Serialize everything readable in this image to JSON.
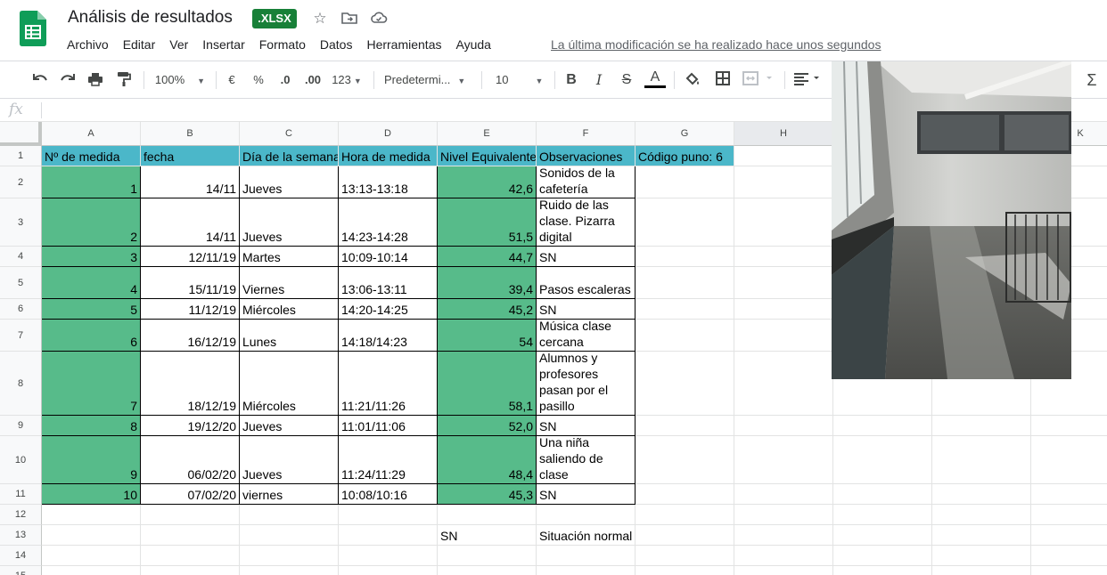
{
  "app": {
    "title": "Análisis de resultados",
    "file_badge": ".XLSX",
    "last_edit": "La última modificación se ha realizado hace unos segundos",
    "menu": [
      "Archivo",
      "Editar",
      "Ver",
      "Insertar",
      "Formato",
      "Datos",
      "Herramientas",
      "Ayuda"
    ],
    "icons": [
      "star-icon",
      "move-to-folder-icon",
      "cloud-status-icon"
    ]
  },
  "toolbar": {
    "zoom": "100%",
    "currency": "€",
    "percent": "%",
    "decrease_decimals": ".0",
    "increase_decimals": ".00",
    "more_formats": "123",
    "font": "Predetermi...",
    "font_size": "10",
    "bold": "B",
    "italic": "I",
    "strike": "S",
    "text_color": "A",
    "sum": "Σ"
  },
  "formula_bar": {
    "label": "fx",
    "content": ""
  },
  "sheet": {
    "columns": [
      "A",
      "B",
      "C",
      "D",
      "E",
      "F",
      "G",
      "H",
      "I",
      "J",
      "K"
    ],
    "row_numbers": [
      "1",
      "2",
      "3",
      "4",
      "5",
      "6",
      "7",
      "8",
      "9",
      "10",
      "11",
      "12",
      "13",
      "14",
      "15"
    ],
    "headers": {
      "A": "Nº de medida",
      "B": "fecha",
      "C": "Día de la semana",
      "D": "Hora de medida",
      "E": "Nivel Equivalente",
      "F": "Observaciones",
      "G": "Código puno: 6"
    },
    "rows": [
      {
        "n": "1",
        "fecha": "14/11",
        "dia": "Jueves",
        "hora": "13:13-13:18",
        "nivel": "42,6",
        "obs": "Sonidos de la cafetería"
      },
      {
        "n": "2",
        "fecha": "14/11",
        "dia": "Jueves",
        "hora": "14:23-14:28",
        "nivel": "51,5",
        "obs": "Ruido de las clase. Pizarra digital"
      },
      {
        "n": "3",
        "fecha": "12/11/19",
        "dia": "Martes",
        "hora": "10:09-10:14",
        "nivel": "44,7",
        "obs": "SN"
      },
      {
        "n": "4",
        "fecha": "15/11/19",
        "dia": "Viernes",
        "hora": "13:06-13:11",
        "nivel": "39,4",
        "obs": "Pasos escaleras"
      },
      {
        "n": "5",
        "fecha": "11/12/19",
        "dia": "Miércoles",
        "hora": "14:20-14:25",
        "nivel": "45,2",
        "obs": "SN"
      },
      {
        "n": "6",
        "fecha": "16/12/19",
        "dia": "Lunes",
        "hora": "14:18/14:23",
        "nivel": "54",
        "obs": "Música clase cercana"
      },
      {
        "n": "7",
        "fecha": "18/12/19",
        "dia": "Miércoles",
        "hora": "11:21/11:26",
        "nivel": "58,1",
        "obs": "Alumnos y profesores pasan por el pasillo"
      },
      {
        "n": "8",
        "fecha": "19/12/20",
        "dia": "Jueves",
        "hora": "11:01/11:06",
        "nivel": "52,0",
        "obs": "SN"
      },
      {
        "n": "9",
        "fecha": "06/02/20",
        "dia": "Jueves",
        "hora": "11:24/11:29",
        "nivel": "48,4",
        "obs": "Una niña saliendo de clase"
      },
      {
        "n": "10",
        "fecha": "07/02/20",
        "dia": "viernes",
        "hora": "10:08/10:16",
        "nivel": "45,3",
        "obs": "SN"
      }
    ],
    "legend": {
      "code": "SN",
      "meaning": "Situación normal"
    }
  },
  "colors": {
    "header_fill": "#4bb7c9",
    "green_fill": "#57bb8a",
    "badge": "#188038"
  }
}
